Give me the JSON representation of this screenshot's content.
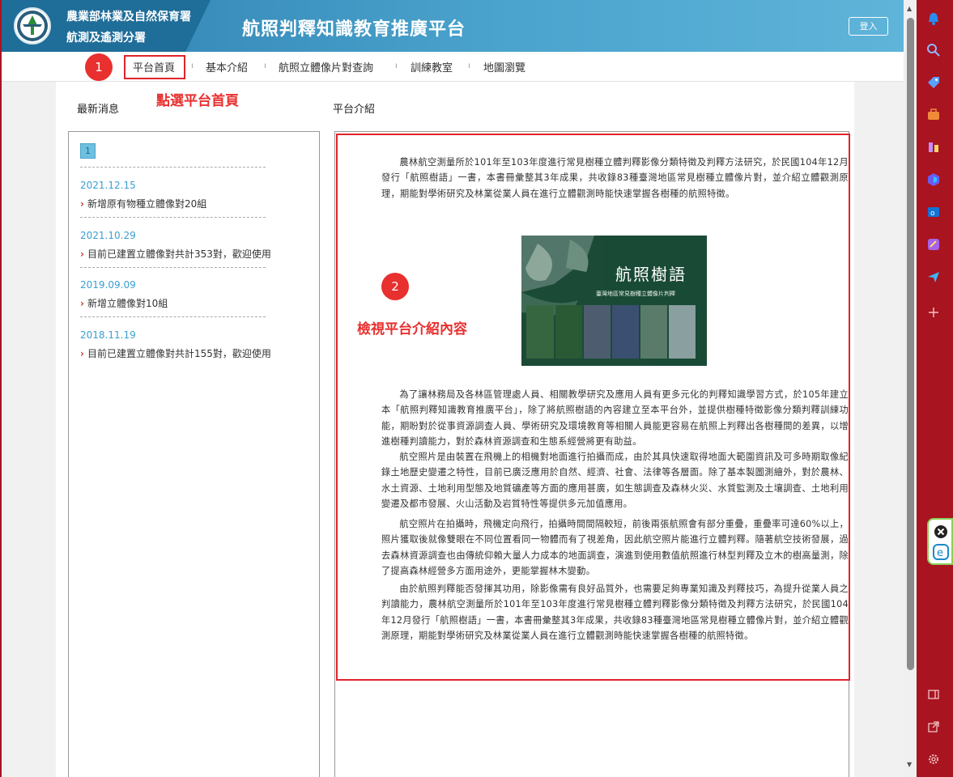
{
  "header": {
    "org_line1": "農業部林業及自然保育署",
    "org_line2": "航測及遙測分署",
    "site_title": "航照判釋知識教育推廣平台",
    "login_label": "登入"
  },
  "nav": {
    "items": [
      {
        "label": "平台首頁"
      },
      {
        "label": "基本介紹"
      },
      {
        "label": "航照立體像片對查詢"
      },
      {
        "label": "訓練教室"
      },
      {
        "label": "地圖瀏覽"
      }
    ]
  },
  "annotations": {
    "step1_number": "1",
    "step1_note": "點選平台首頁",
    "step2_number": "2",
    "step2_note": "檢視平台介紹內容"
  },
  "news": {
    "title": "最新消息",
    "page": "1",
    "items": [
      {
        "date": "2021.12.15",
        "text": "新增原有物種立體像對20組"
      },
      {
        "date": "2021.10.29",
        "text": "目前已建置立體像對共計353對，歡迎使用"
      },
      {
        "date": "2019.09.09",
        "text": "新增立體像對10組"
      },
      {
        "date": "2018.11.19",
        "text": "目前已建置立體像對共計155對，歡迎使用"
      }
    ]
  },
  "intro": {
    "title": "平台介紹",
    "book_title": "航照樹語",
    "book_subtitle": "臺灣地區常見樹種立體像片判釋",
    "paragraphs": [
      "農林航空測量所於101年至103年度進行常見樹種立體判釋影像分類特徵及判釋方法研究，於民國104年12月發行「航照樹語」一書，本書冊彙整其3年成果，共收錄83種臺灣地區常見樹種立體像片對，並介紹立體觀測原理，期能對學術研究及林業從業人員在進行立體觀測時能快速掌握各樹種的航照特徵。",
      "為了讓林務局及各林區管理處人員、相關教學研究及應用人員有更多元化的判釋知識學習方式，於105年建立本「航照判釋知識教育推廣平台」，除了將航照樹語的內容建立至本平台外，並提供樹種特徵影像分類判釋訓練功能，期盼對於從事資源調查人員、學術研究及環境教育等相關人員能更容易在航照上判釋出各樹種間的差異，以增進樹種判讀能力，對於森林資源調查和生態系經營將更有助益。",
      "航空照片是由裝置在飛機上的相機對地面進行拍攝而成，由於其具快速取得地面大範圍資訊及可多時期取像紀錄土地歷史變遷之特性，目前已廣泛應用於自然、經濟、社會、法律等各層面。除了基本製圖測繪外，對於農林、水土資源、土地利用型態及地質礦產等方面的應用甚廣，如生態調查及森林火災、水質監測及土壤調查、土地利用變遷及都市發展、火山活動及岩質特性等提供多元加值應用。",
      "航空照片在拍攝時，飛機定向飛行，拍攝時間間隔較短，前後兩張航照會有部分重疊，重疊率可達60%以上，照片獲取後就像雙眼在不同位置看同一物體而有了視差角，因此航空照片能進行立體判釋。隨著航空技術發展，過去森林資源調查也由傳統仰賴大量人力成本的地面調查，演進到使用數值航照進行林型判釋及立木的樹高量測，除了提高森林經營多方面用途外，更能掌握林木變動。",
      "由於航照判釋能否發揮其功用，除影像需有良好品質外，也需要足夠專業知識及判釋技巧，為提升從業人員之判讀能力，農林航空測量所於101年至103年度進行常見樹種立體判釋影像分類特徵及判釋方法研究，於民國104年12月發行「航照樹語」一書，本書冊彙整其3年成果，共收錄83種臺灣地區常見樹種立體像片對，並介紹立體觀測原理，期能對學術研究及林業從業人員在進行立體觀測時能快速掌握各樹種的航照特徵。"
    ]
  },
  "colors": {
    "header_blue": "#4aa3cd",
    "annotation_red": "#e8302f",
    "sidebar_red": "#a8141f",
    "date_blue": "#3b9fd0"
  },
  "sidebar_icons": [
    "bell-icon",
    "search-icon",
    "tag-icon",
    "briefcase-icon",
    "games-icon",
    "copilot-icon",
    "outlook-icon",
    "designer-icon",
    "send-icon",
    "plus-icon",
    "sidebar-toggle-icon",
    "open-external-icon",
    "settings-icon"
  ]
}
